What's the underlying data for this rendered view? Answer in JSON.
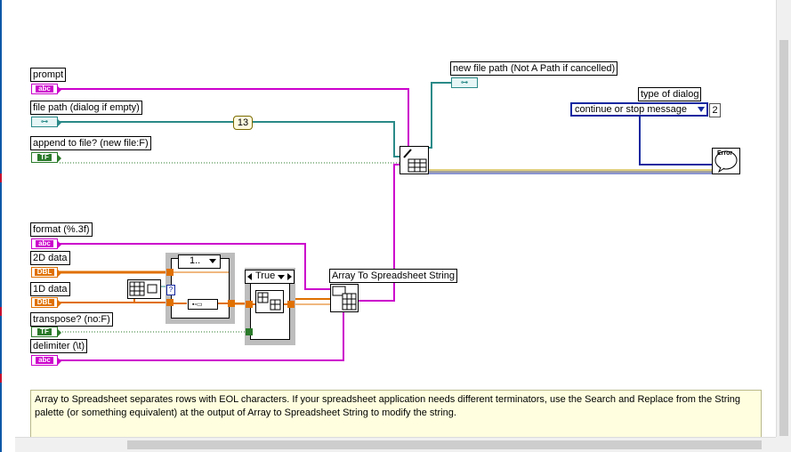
{
  "controls": {
    "prompt": {
      "label": "prompt",
      "terminal": "abc"
    },
    "file_path": {
      "label": "file path (dialog if empty)",
      "terminal": "path"
    },
    "append": {
      "label": "append to file? (new file:F)",
      "terminal": "TF"
    },
    "format": {
      "label": "format (%.3f)",
      "terminal": "abc"
    },
    "data_2d": {
      "label": "2D data",
      "terminal": "DBL"
    },
    "data_1d": {
      "label": "1D data",
      "terminal": "DBL"
    },
    "transpose": {
      "label": "transpose? (no:F)",
      "terminal": "TF"
    },
    "delimiter": {
      "label": "delimiter (\\t)",
      "terminal": "abc"
    }
  },
  "indicators": {
    "new_file_path": {
      "label": "new file path (Not A Path if cancelled)"
    }
  },
  "constants": {
    "n13": "13",
    "type_of_dialog_label": "type of dialog",
    "type_of_dialog_value": "continue or stop message",
    "type_of_dialog_number": "2"
  },
  "nodes": {
    "array_to_spreadsheet": "Array To Spreadsheet String",
    "case_selector": "True",
    "loop_selector": "1..",
    "question_mark": "?",
    "error_text": "Error"
  },
  "note": "Array to Spreadsheet separates rows with EOL characters.  If your spreadsheet application needs different terminators, use the Search and Replace from the String palette (or something equivalent) at the output of Array to Spreadsheet String to modify the string.",
  "colors": {
    "string_wire": "#cc00cc",
    "path_wire": "#2a8a88",
    "bool_wire": "#2a7a2a",
    "dbl_wire": "#e07000",
    "enum": "#1428a0",
    "error_wire": "#c0a000"
  }
}
